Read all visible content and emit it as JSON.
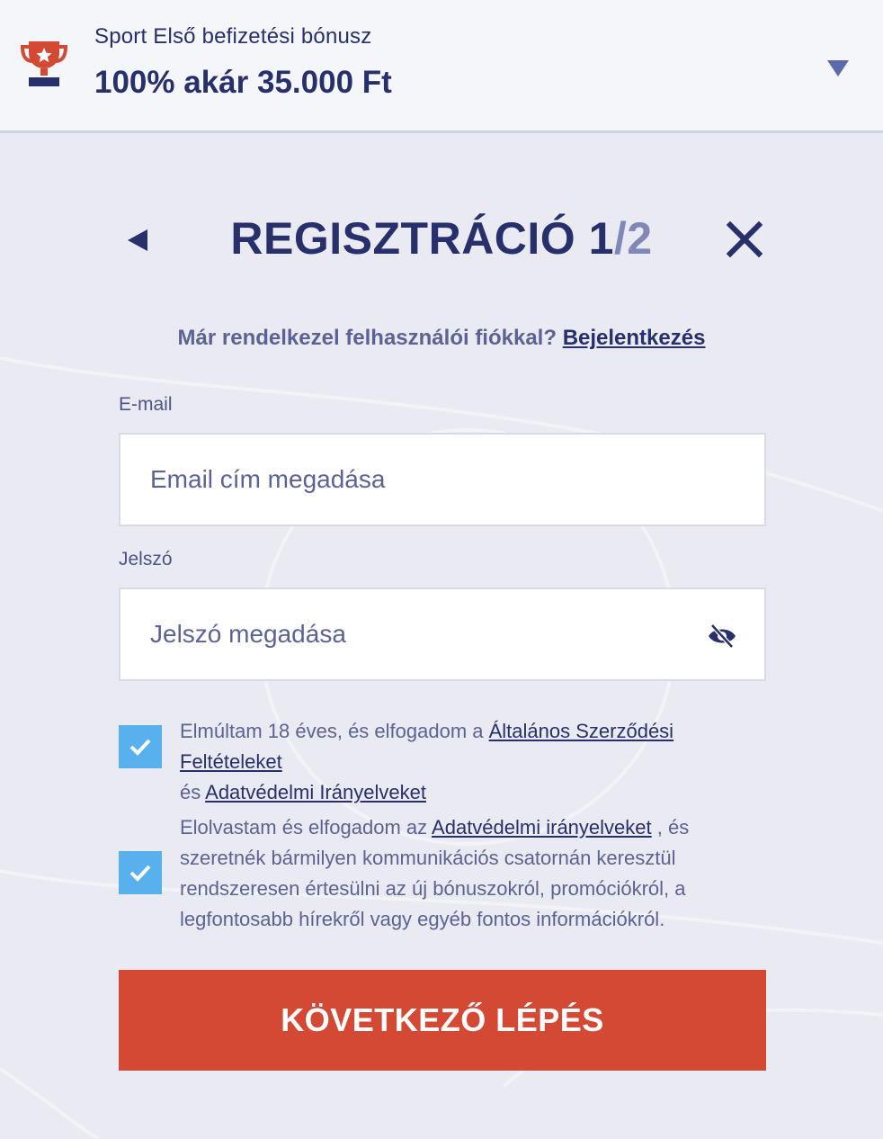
{
  "bonus": {
    "subtitle": "Sport Első befizetési bónusz",
    "amount": "100% akár 35.000 Ft"
  },
  "header": {
    "title_main": "REGISZTRÁCIÓ 1",
    "title_total": "/2"
  },
  "login_prompt": {
    "text": "Már rendelkezel felhasználói fiókkal? ",
    "link": "Bejelentkezés"
  },
  "email": {
    "label": "E-mail",
    "placeholder": "Email cím megadása"
  },
  "password": {
    "label": "Jelszó",
    "placeholder": "Jelszó megadása"
  },
  "consent_terms": {
    "checked": true,
    "text_before": "Elmúltam 18 éves, és elfogadom a ",
    "link1": "Általános Szerződési Feltételeket",
    "text_mid": " és ",
    "link2": "Adatvédelmi Irányelveket"
  },
  "consent_marketing": {
    "checked": true,
    "text_before": "Elolvastam és elfogadom az ",
    "link": "Adatvédelmi irányelveket",
    "text_after": " , és szeretnék bármilyen kommunikációs csatornán keresztül rendszeresen értesülni az új bónuszokról, promóciókról, a legfontosabb hírekről vagy egyéb fontos információkról."
  },
  "next_button": "KÖVETKEZŐ LÉPÉS",
  "colors": {
    "primary": "#27306b",
    "accent_red": "#d44934",
    "checkbox_blue": "#58b1ec",
    "background": "#e9eaf2"
  }
}
